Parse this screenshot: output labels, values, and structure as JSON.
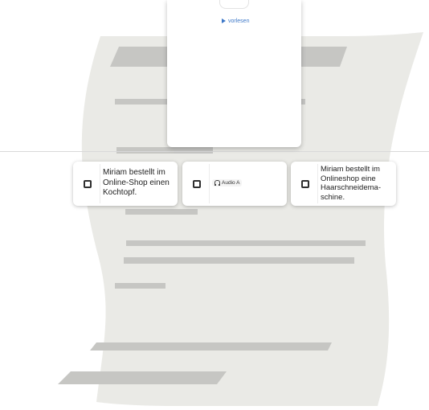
{
  "card": {
    "read_aloud_label": "vorlesen"
  },
  "options": [
    {
      "text": "Miriam bestellt im Online-Shop einen Kochtopf.",
      "checked": false
    },
    {
      "audio_label": "Audio A",
      "checked": false
    },
    {
      "text": "Miriam bestellt im Onlineshop eine Haarschneidema-schine.",
      "checked": false
    }
  ],
  "colors": {
    "paper": "#eaeae6",
    "paper_lines": "#c6c6c3",
    "link": "#3d78c8"
  }
}
